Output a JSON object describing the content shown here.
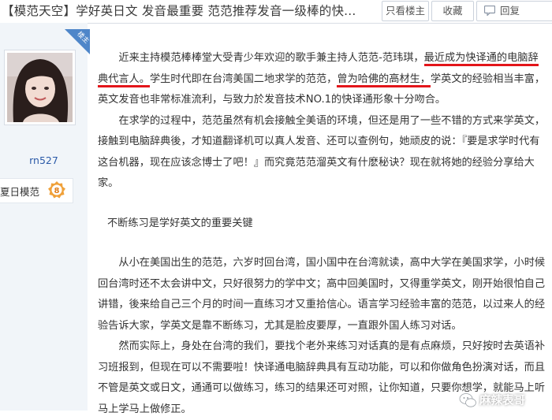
{
  "thread": {
    "title": "【模范天空】学好英日文 发音最重要 范范推荐发音一级棒的快..."
  },
  "toolbar": {
    "only_host_label": "只看楼主",
    "collect_label": "收藏",
    "reply_label": "回复"
  },
  "author": {
    "badge_label": "楼主",
    "name": "rn527",
    "level_name": "夏日模范",
    "level": "8"
  },
  "post": {
    "p1": {
      "a": "近来主持模范棒棒堂大受青少年欢迎的歌手兼主持人范范-范玮琪，",
      "b": "最近成为快译通的电脑辞典代言人。",
      "c": "学生时代即在台湾美国二地求学的范范，",
      "d": "曾为哈佛的高材生，",
      "e": "学英文的经验相当丰富，英文发音也非常标准流利，与致力於发音技术NO.1的快译通形象十分吻合。"
    },
    "p2": "在求学的过程中，范范虽然有机会接触全美语的环境，但还是用了一些不错的方式来学英文，接触到电脑辞典後，才知道翻译机可以真人发音、还可以查例句，她顽皮的说：『要是求学时代有这台机器，现在应该念博士了吧！』而究竟范范溜英文有什麽秘诀？现在就将她的经验分享给大家。",
    "subtitle": "不断练习是学好英文的重要关键",
    "p3": "从小在美国出生的范范，六岁时回台湾，国小国中在台湾就读，高中大学在美国求学，小时候回台湾时还不太会讲中文，只好很努力的学中文；高中回美国时，又得重学英文，刚开始很怕自己讲错，後来给自己三个月的时间一直练习才又重拾信心。语言学习经验丰富的范范，以过来人的经验告诉大家，学英文是靠不断练习，尤其是脸皮要厚，一直跟外国人练习对话。",
    "p4": "然而实际上，身处在台湾的我们，要找个老外来练习对话真的是有点麻烦，只好按时去英语补习班报到，但现在可以不需要啦！快译通电脑辞典具有互动功能，可以和你做角色扮演对话，而且不管是英文或日文，通通可以做练习，练习的结果还可对照，让你知道，只要你想学，就能马上听马上学马上做修正。"
  },
  "watermark": {
    "text": "麻辣表哥"
  },
  "colors": {
    "underline": "#e3151a",
    "sidebar_bg": "#f1f5f9",
    "name_link": "#2b5aa8",
    "badge_blue": "#4e86c9",
    "level_orange": "#f0a13a"
  }
}
